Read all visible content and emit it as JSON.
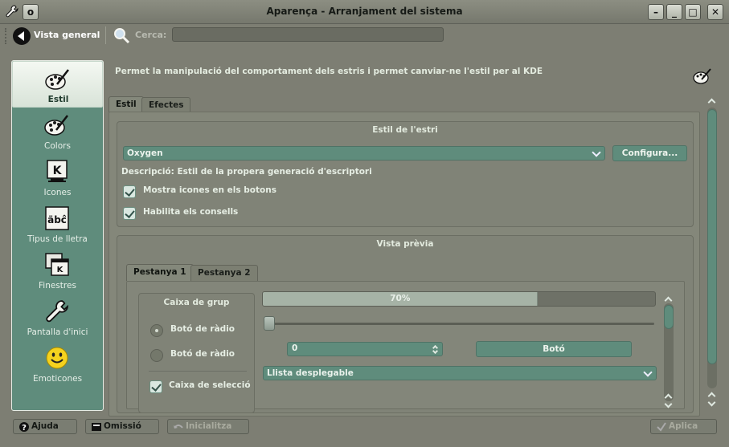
{
  "window": {
    "title": "Aparença - Arranjament del sistema",
    "menu_glyph": "o",
    "minimize_glyph": "–",
    "maximize_glyph": "□",
    "close_glyph": "✕"
  },
  "toolbar": {
    "overview_label": "Vista general",
    "search_label": "Cerca:",
    "search_value": ""
  },
  "sidebar": {
    "items": [
      {
        "label": "Estil",
        "icon": "paint-palette-icon",
        "active": true
      },
      {
        "label": "Colors",
        "icon": "color-palette-icon",
        "active": false
      },
      {
        "label": "Icones",
        "icon": "kde-icons-icon",
        "active": false
      },
      {
        "label": "Tipus de lletra",
        "icon": "font-abc-icon",
        "active": false
      },
      {
        "label": "Finestres",
        "icon": "windows-icon",
        "active": false
      },
      {
        "label": "Pantalla d'inici",
        "icon": "wrench-icon",
        "active": false
      },
      {
        "label": "Emoticones",
        "icon": "smiley-icon",
        "active": false
      }
    ]
  },
  "main": {
    "description": "Permet la manipulació del comportament dels estris i permet canviar-ne l'estil per al KDE",
    "tabs": [
      {
        "label": "Estil",
        "active": true
      },
      {
        "label": "Efectes",
        "active": false
      }
    ],
    "widget_style": {
      "title": "Estil de l'estri",
      "selected_style": "Oxygen",
      "configure_label": "Configura...",
      "description": "Descripció: Estil de la propera generació d'escriptori",
      "show_icons_label": "Mostra icones en els botons",
      "show_icons_checked": true,
      "enable_tooltips_label": "Habilita els consells",
      "enable_tooltips_checked": true
    },
    "preview": {
      "title": "Vista prèvia",
      "tabs": [
        {
          "label": "Pestanya 1",
          "active": true
        },
        {
          "label": "Pestanya 2",
          "active": false
        }
      ],
      "groupbox_title": "Caixa de grup",
      "radio1_label": "Botó de ràdio",
      "radio1_checked": true,
      "radio2_label": "Botó de ràdio",
      "radio2_checked": false,
      "checkbox_label": "Caixa de selecció",
      "checkbox_checked": true,
      "progress_percent": 70,
      "progress_text": "70%",
      "slider_value": 0,
      "spinbox_value": "0",
      "button_label": "Botó",
      "dropdown_label": "Llista desplegable"
    }
  },
  "buttons": {
    "help": "Ajuda",
    "default": "Omissió",
    "reset": "Inicialitza",
    "apply": "Aplica"
  },
  "colors": {
    "accent": "#5f8c7c",
    "background": "#7d7e73"
  }
}
